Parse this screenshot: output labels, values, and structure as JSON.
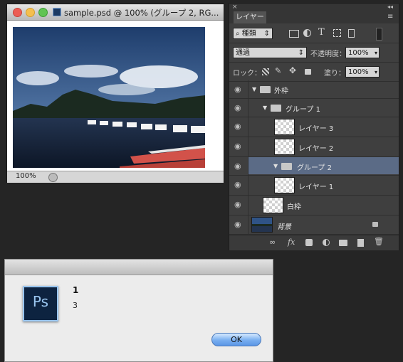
{
  "document": {
    "title": "sample.psd @ 100% (グループ 2, RG...",
    "zoom": "100%",
    "traffic_lights": [
      "#ec5d54",
      "#f4bf4f",
      "#61c454"
    ]
  },
  "layers_panel": {
    "close_glyph": "×",
    "collapse_glyph": "◂◂",
    "tab_label": "レイヤー",
    "menu_glyph": "≡",
    "filter": {
      "label": "種類",
      "search_icon": "⌕",
      "stepper": "⇕"
    },
    "filter_icons": [
      "image-icon",
      "adjustment-icon",
      "type-icon",
      "shape-icon",
      "smart-object-icon"
    ],
    "blend_mode": "通過",
    "opacity_label": "不透明度：",
    "opacity_value": "100%",
    "lock_label": "ロック：",
    "fill_label": "塗り：",
    "fill_value": "100%",
    "layers": [
      {
        "name": "外枠",
        "kind": "group"
      },
      {
        "name": "グループ 1",
        "kind": "group"
      },
      {
        "name": "レイヤー 3",
        "kind": "layer"
      },
      {
        "name": "レイヤー 2",
        "kind": "layer"
      },
      {
        "name": "グループ 2",
        "kind": "group",
        "selected": true
      },
      {
        "name": "レイヤー 1",
        "kind": "layer"
      },
      {
        "name": "白枠",
        "kind": "layer"
      },
      {
        "name": "背景",
        "kind": "background"
      }
    ]
  },
  "dialog": {
    "line1": "1",
    "line2": "3",
    "icon_text": "Ps",
    "ok_label": "OK"
  },
  "colors": {
    "selected_row": "#5b6b86",
    "panel_bg": "#3f3f3f",
    "ps_blue": "#9ac6f0"
  }
}
